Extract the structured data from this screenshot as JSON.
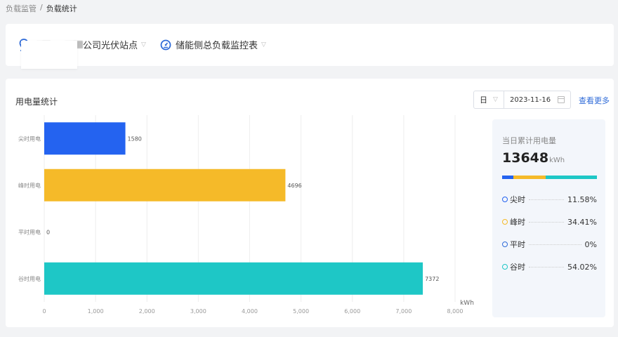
{
  "breadcrumb": {
    "parent": "负载监管",
    "separator": "/",
    "current": "负载统计"
  },
  "header": {
    "station_name": "公司光伏站点",
    "meter_name": "储能侧总负载监控表"
  },
  "colors": {
    "accent": "#2f6bd8",
    "peak_sharp": "#2463f0",
    "peak": "#f5ba29",
    "flat": "#2f6bd8",
    "valley": "#1ec7c6"
  },
  "stats": {
    "title": "用电量统计",
    "period": "日",
    "date": "2023-11-16",
    "more_link": "查看更多"
  },
  "chart_data": {
    "type": "bar",
    "orientation": "horizontal",
    "categories": [
      "尖时用电",
      "峰时用电",
      "平时用电",
      "谷时用电"
    ],
    "values": [
      1580,
      4696,
      0,
      7372
    ],
    "data_labels": [
      "1580",
      "4696",
      "0",
      "7372"
    ],
    "colors": [
      "#2463f0",
      "#f5ba29",
      "#2f6bd8",
      "#1ec7c6"
    ],
    "xlim": [
      0,
      8000
    ],
    "xticks": [
      "0",
      "1,000",
      "2,000",
      "3,000",
      "4,000",
      "5,000",
      "6,000",
      "7,000",
      "8,000"
    ],
    "xunit": "kWh",
    "grid": true
  },
  "summary": {
    "label": "当日累计用电量",
    "total": "13648",
    "unit": "kWh",
    "ratio": [
      0.1158,
      0.3441,
      0.0,
      0.5402
    ],
    "items": [
      {
        "name": "尖时",
        "pct": "11.58%",
        "color": "#2463f0"
      },
      {
        "name": "峰时",
        "pct": "34.41%",
        "color": "#f5ba29"
      },
      {
        "name": "平时",
        "pct": "0%",
        "color": "#2f6bd8"
      },
      {
        "name": "谷时",
        "pct": "54.02%",
        "color": "#1ec7c6"
      }
    ]
  }
}
